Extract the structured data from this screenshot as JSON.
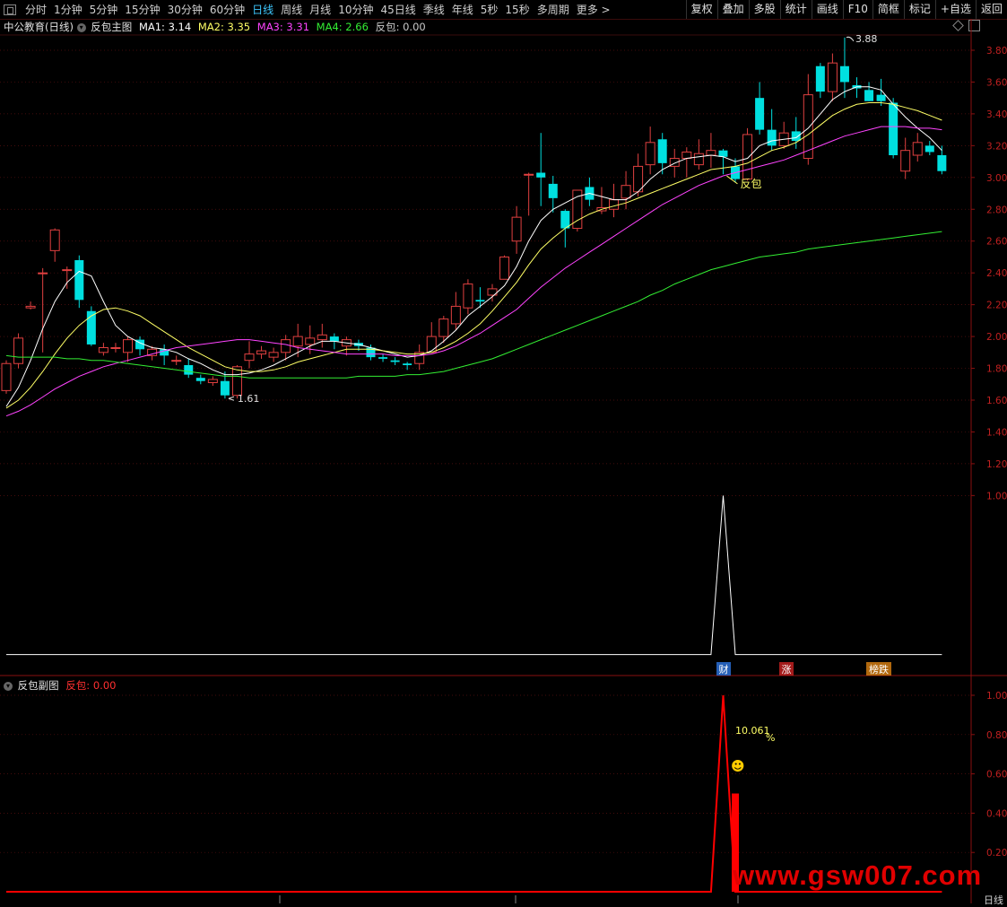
{
  "toolbar": {
    "periods": [
      "分时",
      "1分钟",
      "5分钟",
      "15分钟",
      "30分钟",
      "60分钟",
      "日线",
      "周线",
      "月线",
      "10分钟",
      "45日线",
      "季线",
      "年线",
      "5秒",
      "15秒",
      "多周期",
      "更多 >"
    ],
    "active_period": "日线",
    "tools": [
      "复权",
      "叠加",
      "多股",
      "统计",
      "画线",
      "F10",
      "简框",
      "标记",
      "+自选",
      "返回"
    ]
  },
  "main_legend": {
    "stock": "中公教育(日线)",
    "indicator": "反包主图",
    "ma1": "MA1: 3.14",
    "ma2": "MA2: 3.35",
    "ma3": "MA3: 3.31",
    "ma4": "MA4: 2.66",
    "fanbao": "反包: 0.00"
  },
  "sub_legend": {
    "indicator": "反包副图",
    "fanbao": "反包: 0.00"
  },
  "annotations": {
    "high": "3.88",
    "low": "1.61",
    "signal": "反包",
    "pct": "10.061",
    "pct_suffix": "%",
    "smiley": "☻"
  },
  "badges": [
    "财",
    "涨",
    "榜跌"
  ],
  "badge_colors": [
    "#2a6fd6",
    "#c02020",
    "#d07a10"
  ],
  "watermark": "www.gsw007.com",
  "bottom_right": "日线",
  "colors": {
    "up": "#e04040",
    "down": "#00e0e0",
    "ma1": "#ffffff",
    "ma2": "#ffff66",
    "ma3": "#ff44ff",
    "ma4": "#33ee33",
    "grid": "#5a1010",
    "axis_label": "#c02020",
    "sub_line": "#ff0000"
  },
  "chart_data": [
    {
      "type": "candlestick",
      "title": "中公教育(日线)",
      "ylim": [
        1.36,
        3.98
      ],
      "yticks": [
        "3.80",
        "3.60",
        "3.40",
        "3.20",
        "3.00",
        "2.80",
        "2.60",
        "2.40",
        "2.20",
        "2.00",
        "1.80",
        "1.60",
        "1.40",
        "1.20",
        "1.00"
      ],
      "candles": [
        [
          1.66,
          1.83,
          1.64,
          1.85
        ],
        [
          1.83,
          1.99,
          1.8,
          2.02
        ],
        [
          2.18,
          2.19,
          2.17,
          2.22
        ],
        [
          2.4,
          2.4,
          1.9,
          2.43
        ],
        [
          2.54,
          2.67,
          2.47,
          2.68
        ],
        [
          2.42,
          2.42,
          2.3,
          2.44
        ],
        [
          2.48,
          2.23,
          2.18,
          2.51
        ],
        [
          2.16,
          1.95,
          1.94,
          2.19
        ],
        [
          1.9,
          1.93,
          1.88,
          1.96
        ],
        [
          1.93,
          1.93,
          1.9,
          1.96
        ],
        [
          1.9,
          1.98,
          1.84,
          2.0
        ],
        [
          1.98,
          1.92,
          1.88,
          2.0
        ],
        [
          1.88,
          1.92,
          1.85,
          1.94
        ],
        [
          1.92,
          1.88,
          1.82,
          1.95
        ],
        [
          1.85,
          1.85,
          1.82,
          1.88
        ],
        [
          1.82,
          1.76,
          1.74,
          1.86
        ],
        [
          1.74,
          1.72,
          1.7,
          1.76
        ],
        [
          1.71,
          1.73,
          1.69,
          1.75
        ],
        [
          1.72,
          1.63,
          1.61,
          1.78
        ],
        [
          1.63,
          1.81,
          1.61,
          1.82
        ],
        [
          1.85,
          1.89,
          1.8,
          1.97
        ],
        [
          1.89,
          1.91,
          1.86,
          1.94
        ],
        [
          1.87,
          1.9,
          1.84,
          1.93
        ],
        [
          1.9,
          1.98,
          1.85,
          2.01
        ],
        [
          1.94,
          2.0,
          1.87,
          2.08
        ],
        [
          1.95,
          1.99,
          1.89,
          2.07
        ],
        [
          1.98,
          2.01,
          1.93,
          2.08
        ],
        [
          2.0,
          1.97,
          1.92,
          2.02
        ],
        [
          1.94,
          1.98,
          1.88,
          2.0
        ],
        [
          1.96,
          1.94,
          1.91,
          1.98
        ],
        [
          1.93,
          1.87,
          1.85,
          1.95
        ],
        [
          1.87,
          1.86,
          1.84,
          1.89
        ],
        [
          1.85,
          1.84,
          1.82,
          1.87
        ],
        [
          1.83,
          1.82,
          1.79,
          1.84
        ],
        [
          1.83,
          1.9,
          1.79,
          1.95
        ],
        [
          1.9,
          2.0,
          1.9,
          2.09
        ],
        [
          2.0,
          2.11,
          1.96,
          2.13
        ],
        [
          2.08,
          2.19,
          2.04,
          2.28
        ],
        [
          2.18,
          2.33,
          2.14,
          2.36
        ],
        [
          2.23,
          2.22,
          2.18,
          2.31
        ],
        [
          2.26,
          2.3,
          2.22,
          2.33
        ],
        [
          2.36,
          2.5,
          2.36,
          2.51
        ],
        [
          2.6,
          2.75,
          2.52,
          2.82
        ],
        [
          3.02,
          3.02,
          2.76,
          3.03
        ],
        [
          3.03,
          3.0,
          2.82,
          3.28
        ],
        [
          2.96,
          2.87,
          2.78,
          3.01
        ],
        [
          2.79,
          2.68,
          2.56,
          2.8
        ],
        [
          2.68,
          2.92,
          2.66,
          2.92
        ],
        [
          2.94,
          2.86,
          2.82,
          3.0
        ],
        [
          2.79,
          2.81,
          2.77,
          2.94
        ],
        [
          2.8,
          2.86,
          2.75,
          2.96
        ],
        [
          2.87,
          2.95,
          2.8,
          3.04
        ],
        [
          2.91,
          3.07,
          2.88,
          3.15
        ],
        [
          3.08,
          3.22,
          3.02,
          3.32
        ],
        [
          3.24,
          3.09,
          3.02,
          3.28
        ],
        [
          3.07,
          3.12,
          3.0,
          3.18
        ],
        [
          3.12,
          3.16,
          3.0,
          3.19
        ],
        [
          3.08,
          3.15,
          3.05,
          3.24
        ],
        [
          3.14,
          3.17,
          3.06,
          3.28
        ],
        [
          3.17,
          3.13,
          3.02,
          3.18
        ],
        [
          3.07,
          2.99,
          2.97,
          3.12
        ],
        [
          2.99,
          3.27,
          2.98,
          3.31
        ],
        [
          3.5,
          3.3,
          3.27,
          3.6
        ],
        [
          3.3,
          3.2,
          3.17,
          3.43
        ],
        [
          3.2,
          3.28,
          3.18,
          3.35
        ],
        [
          3.29,
          3.23,
          3.18,
          3.38
        ],
        [
          3.12,
          3.52,
          3.08,
          3.65
        ],
        [
          3.7,
          3.54,
          3.5,
          3.72
        ],
        [
          3.54,
          3.72,
          3.48,
          3.78
        ],
        [
          3.7,
          3.6,
          3.5,
          3.88
        ],
        [
          3.58,
          3.56,
          3.5,
          3.63
        ],
        [
          3.55,
          3.48,
          3.48,
          3.6
        ],
        [
          3.52,
          3.48,
          3.45,
          3.62
        ],
        [
          3.47,
          3.14,
          3.12,
          3.5
        ],
        [
          3.04,
          3.17,
          2.99,
          3.25
        ],
        [
          3.14,
          3.22,
          3.1,
          3.28
        ],
        [
          3.2,
          3.16,
          3.14,
          3.23
        ],
        [
          3.14,
          3.04,
          3.02,
          3.2
        ]
      ],
      "series": [
        {
          "name": "MA1",
          "values": [
            1.56,
            1.68,
            1.85,
            2.05,
            2.22,
            2.34,
            2.41,
            2.38,
            2.22,
            2.07,
            2.0,
            1.96,
            1.93,
            1.92,
            1.9,
            1.86,
            1.83,
            1.79,
            1.76,
            1.76,
            1.77,
            1.79,
            1.82,
            1.86,
            1.9,
            1.94,
            1.97,
            1.97,
            1.96,
            1.95,
            1.93,
            1.91,
            1.89,
            1.87,
            1.88,
            1.91,
            1.97,
            2.04,
            2.13,
            2.19,
            2.25,
            2.32,
            2.44,
            2.6,
            2.73,
            2.8,
            2.84,
            2.88,
            2.9,
            2.88,
            2.86,
            2.86,
            2.91,
            2.99,
            3.05,
            3.09,
            3.12,
            3.13,
            3.14,
            3.13,
            3.1,
            3.12,
            3.2,
            3.23,
            3.24,
            3.25,
            3.31,
            3.4,
            3.49,
            3.54,
            3.57,
            3.57,
            3.55,
            3.46,
            3.38,
            3.31,
            3.25,
            3.17
          ]
        },
        {
          "name": "MA2",
          "values": [
            1.55,
            1.6,
            1.68,
            1.78,
            1.89,
            1.99,
            2.07,
            2.13,
            2.17,
            2.18,
            2.16,
            2.13,
            2.08,
            2.03,
            1.98,
            1.93,
            1.89,
            1.85,
            1.81,
            1.79,
            1.78,
            1.78,
            1.79,
            1.81,
            1.84,
            1.86,
            1.88,
            1.9,
            1.92,
            1.92,
            1.92,
            1.91,
            1.9,
            1.89,
            1.89,
            1.9,
            1.93,
            1.97,
            2.02,
            2.08,
            2.16,
            2.25,
            2.34,
            2.45,
            2.55,
            2.62,
            2.68,
            2.73,
            2.77,
            2.8,
            2.82,
            2.84,
            2.87,
            2.9,
            2.93,
            2.96,
            2.99,
            3.02,
            3.05,
            3.06,
            3.07,
            3.09,
            3.13,
            3.17,
            3.19,
            3.22,
            3.27,
            3.33,
            3.39,
            3.43,
            3.46,
            3.47,
            3.47,
            3.46,
            3.44,
            3.42,
            3.39,
            3.36
          ]
        },
        {
          "name": "MA3",
          "values": [
            1.5,
            1.53,
            1.57,
            1.62,
            1.67,
            1.71,
            1.75,
            1.78,
            1.81,
            1.83,
            1.85,
            1.87,
            1.89,
            1.91,
            1.93,
            1.94,
            1.95,
            1.96,
            1.97,
            1.98,
            1.98,
            1.97,
            1.96,
            1.95,
            1.93,
            1.92,
            1.91,
            1.9,
            1.89,
            1.89,
            1.89,
            1.89,
            1.88,
            1.88,
            1.88,
            1.89,
            1.91,
            1.94,
            1.98,
            2.02,
            2.07,
            2.12,
            2.17,
            2.24,
            2.31,
            2.37,
            2.43,
            2.48,
            2.53,
            2.58,
            2.63,
            2.68,
            2.73,
            2.78,
            2.83,
            2.87,
            2.91,
            2.95,
            2.98,
            3.01,
            3.03,
            3.05,
            3.07,
            3.09,
            3.11,
            3.14,
            3.17,
            3.2,
            3.23,
            3.26,
            3.28,
            3.3,
            3.32,
            3.32,
            3.32,
            3.31,
            3.31,
            3.3
          ]
        },
        {
          "name": "MA4",
          "values": [
            1.88,
            1.87,
            1.87,
            1.87,
            1.87,
            1.86,
            1.86,
            1.85,
            1.85,
            1.84,
            1.83,
            1.82,
            1.81,
            1.8,
            1.79,
            1.78,
            1.77,
            1.76,
            1.75,
            1.75,
            1.74,
            1.74,
            1.74,
            1.74,
            1.74,
            1.74,
            1.74,
            1.74,
            1.74,
            1.75,
            1.75,
            1.75,
            1.75,
            1.76,
            1.76,
            1.77,
            1.78,
            1.8,
            1.82,
            1.84,
            1.86,
            1.89,
            1.92,
            1.95,
            1.98,
            2.01,
            2.04,
            2.07,
            2.1,
            2.13,
            2.16,
            2.19,
            2.22,
            2.26,
            2.29,
            2.33,
            2.36,
            2.39,
            2.42,
            2.44,
            2.46,
            2.48,
            2.5,
            2.51,
            2.52,
            2.53,
            2.55,
            2.56,
            2.57,
            2.58,
            2.59,
            2.6,
            2.61,
            2.62,
            2.63,
            2.64,
            2.65,
            2.66
          ]
        },
        {
          "name": "反包",
          "values": [
            0,
            0,
            0,
            0,
            0,
            0,
            0,
            0,
            0,
            0,
            0,
            0,
            0,
            0,
            0,
            0,
            0,
            0,
            0,
            0,
            0,
            0,
            0,
            0,
            0,
            0,
            0,
            0,
            0,
            0,
            0,
            0,
            0,
            0,
            0,
            0,
            0,
            0,
            0,
            0,
            0,
            0,
            0,
            0,
            0,
            0,
            0,
            0,
            0,
            0,
            0,
            0,
            0,
            0,
            0,
            0,
            0,
            0,
            0,
            1,
            0,
            0,
            0,
            0,
            0,
            0,
            0,
            0,
            0,
            0,
            0,
            0,
            0,
            0,
            0,
            0,
            0,
            0
          ]
        }
      ],
      "signal_index": 59,
      "high_index": 69,
      "low_index": 18
    },
    {
      "type": "line",
      "title": "反包副图",
      "ylim": [
        0,
        1.1
      ],
      "yticks": [
        "1.00",
        "0.80",
        "0.60",
        "0.40",
        "0.20"
      ],
      "series": [
        {
          "name": "反包",
          "values": [
            0,
            0,
            0,
            0,
            0,
            0,
            0,
            0,
            0,
            0,
            0,
            0,
            0,
            0,
            0,
            0,
            0,
            0,
            0,
            0,
            0,
            0,
            0,
            0,
            0,
            0,
            0,
            0,
            0,
            0,
            0,
            0,
            0,
            0,
            0,
            0,
            0,
            0,
            0,
            0,
            0,
            0,
            0,
            0,
            0,
            0,
            0,
            0,
            0,
            0,
            0,
            0,
            0,
            0,
            0,
            0,
            0,
            0,
            0,
            1,
            0,
            0,
            0,
            0,
            0,
            0,
            0,
            0,
            0,
            0,
            0,
            0,
            0,
            0,
            0,
            0,
            0,
            0
          ]
        }
      ],
      "bar_index": 60,
      "bar_value": 0.5
    }
  ]
}
